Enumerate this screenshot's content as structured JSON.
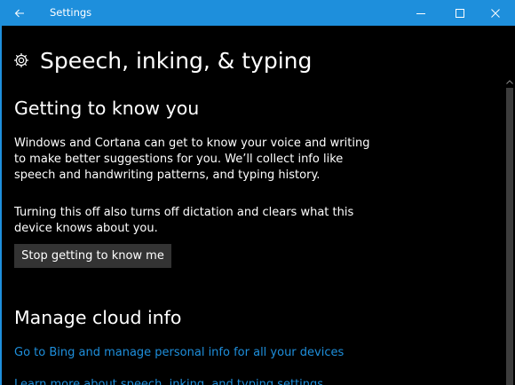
{
  "window": {
    "title": "Settings",
    "accent_color": "#1e8fdc",
    "controls": {
      "back_icon": "back-arrow-icon",
      "minimize_icon": "minimize-icon",
      "maximize_icon": "maximize-icon",
      "close_icon": "close-icon"
    }
  },
  "page": {
    "icon": "gear-icon",
    "title": "Speech, inking, & typing"
  },
  "getting_to_know_you": {
    "heading": "Getting to know you",
    "description": "Windows and Cortana can get to know your voice and writing to make better suggestions for you. We’ll collect info like speech and handwriting patterns, and typing history.",
    "warning": "Turning this off also turns off dictation and clears what this device knows about you.",
    "button_label": "Stop getting to know me"
  },
  "manage_cloud_info": {
    "heading": "Manage cloud info",
    "links": [
      "Go to Bing and manage personal info for all your devices",
      "Learn more about speech, inking, and typing settings"
    ]
  }
}
